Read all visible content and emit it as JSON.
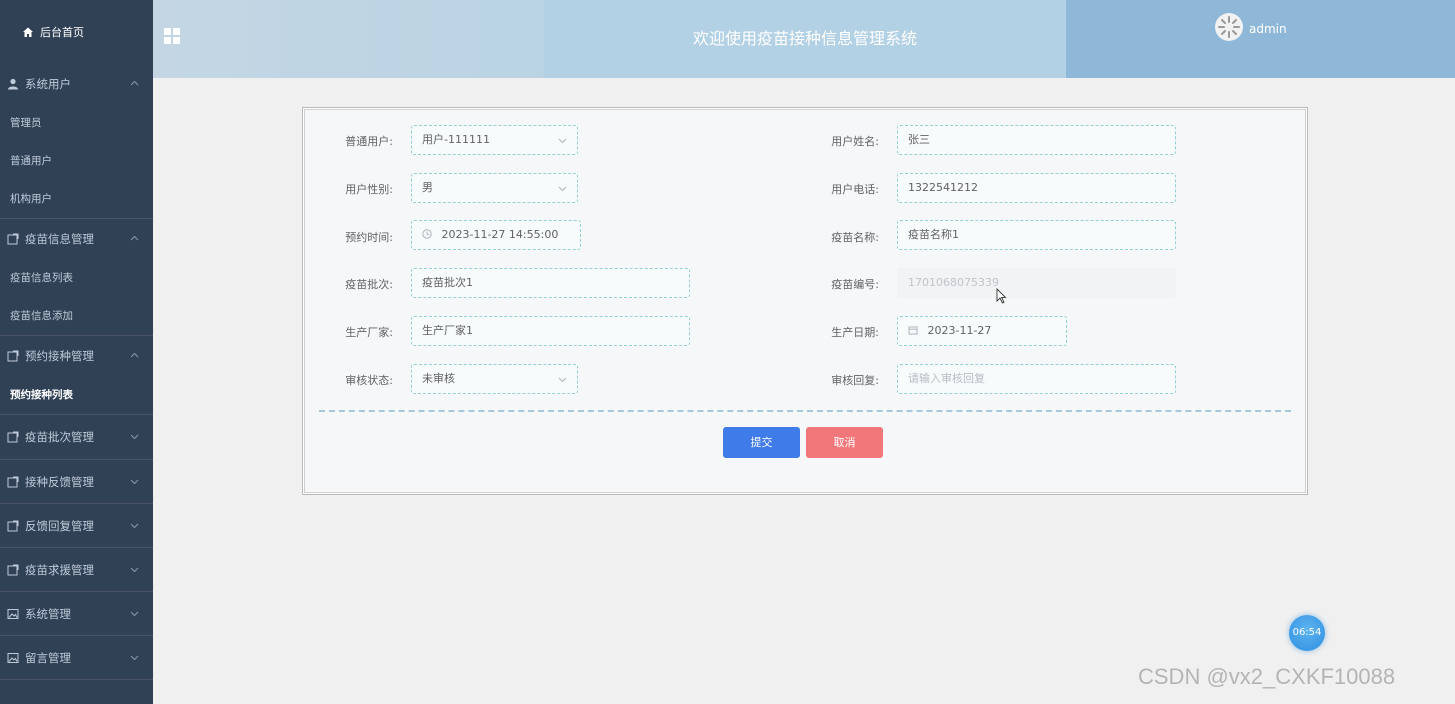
{
  "sidebar": {
    "home": "后台首页",
    "groups": [
      {
        "label": "系统用户",
        "items": [
          "管理员",
          "普通用户",
          "机构用户"
        ]
      },
      {
        "label": "疫苗信息管理",
        "items": [
          "疫苗信息列表",
          "疫苗信息添加"
        ]
      },
      {
        "label": "预约接种管理",
        "items": [
          "预约接种列表"
        ]
      },
      {
        "label": "疫苗批次管理"
      },
      {
        "label": "接种反馈管理"
      },
      {
        "label": "反馈回复管理"
      },
      {
        "label": "疫苗求援管理"
      },
      {
        "label": "系统管理"
      },
      {
        "label": "留言管理"
      }
    ]
  },
  "header": {
    "title": "欢迎使用疫苗接种信息管理系统",
    "username": "admin"
  },
  "form": {
    "user_label": "普通用户:",
    "user_value": "用户-111111",
    "name_label": "用户姓名:",
    "name_value": "张三",
    "gender_label": "用户性别:",
    "gender_value": "男",
    "phone_label": "用户电话:",
    "phone_value": "1322541212",
    "appt_label": "预约时间:",
    "appt_value": "2023-11-27 14:55:00",
    "vname_label": "疫苗名称:",
    "vname_value": "疫苗名称1",
    "batch_label": "疫苗批次:",
    "batch_value": "疫苗批次1",
    "vcode_label": "疫苗编号:",
    "vcode_value": "1701068075339",
    "maker_label": "生产厂家:",
    "maker_value": "生产厂家1",
    "pdate_label": "生产日期:",
    "pdate_value": "2023-11-27",
    "status_label": "审核状态:",
    "status_value": "未审核",
    "reply_label": "审核回复:",
    "reply_placeholder": "请输入审核回复",
    "submit": "提交",
    "cancel": "取消"
  },
  "overlay": {
    "clock": "06:54",
    "watermark": "CSDN @vx2_CXKF10088"
  }
}
